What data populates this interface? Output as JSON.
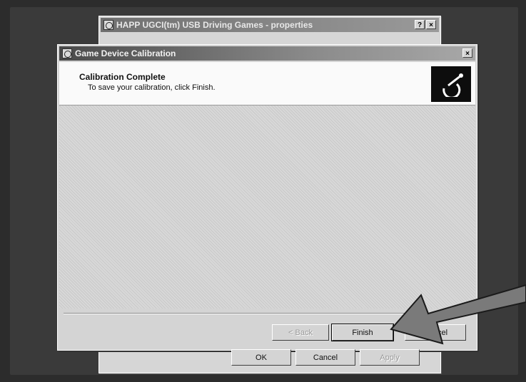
{
  "background_window": {
    "title": "HAPP UGCI(tm) USB Driving Games - properties",
    "help_btn": "?",
    "close_btn": "×",
    "buttons": {
      "ok": "OK",
      "cancel": "Cancel",
      "apply": "Apply"
    }
  },
  "dialog": {
    "title": "Game Device Calibration",
    "close_btn": "×",
    "header_title": "Calibration Complete",
    "header_subtitle": "To save your calibration, click Finish.",
    "buttons": {
      "back": "< Back",
      "finish": "Finish",
      "cancel": "Cancel"
    }
  },
  "icons": {
    "app_icon": "game-controller-icon",
    "logo_icon": "joystick-logo-icon"
  },
  "colors": {
    "header_bg": "#fafafa",
    "logo_bg": "#0d0d0d",
    "arrow": "#7a7a7a"
  }
}
